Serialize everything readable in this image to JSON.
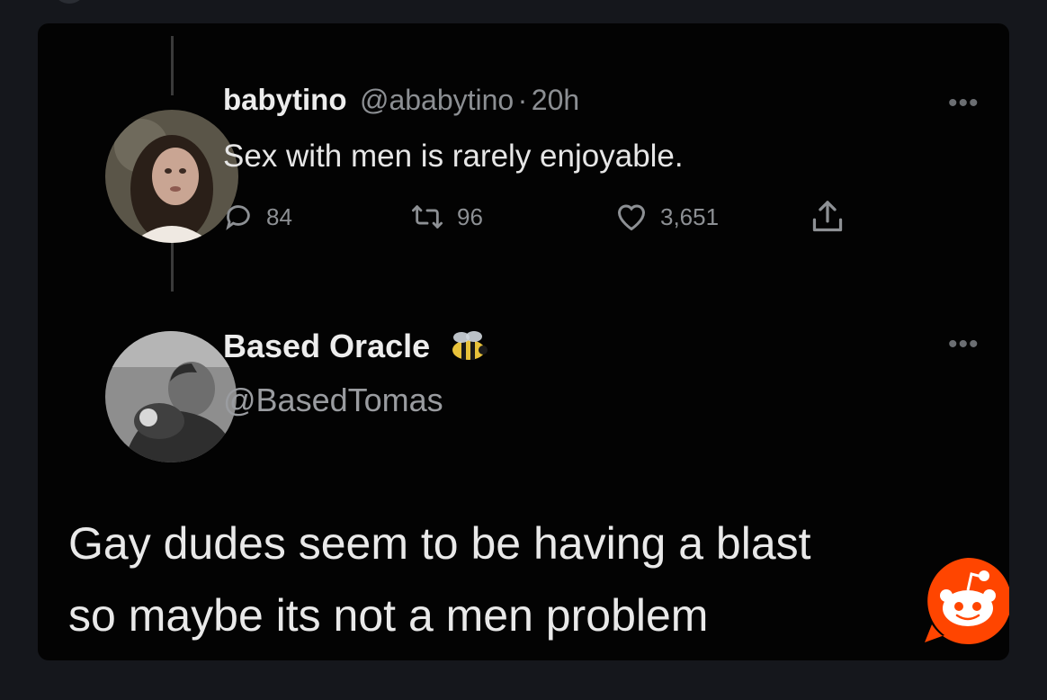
{
  "tweet1": {
    "display_name": "babytino",
    "handle": "@ababytino",
    "separator": "·",
    "time": "20h",
    "text": "Sex with men is rarely enjoyable.",
    "reply_count": "84",
    "retweet_count": "96",
    "like_count": "3,651"
  },
  "tweet2": {
    "display_name": "Based Oracle",
    "handle": "@BasedTomas",
    "text_line1": "Gay dudes seem to be having a blast",
    "text_line2": "so maybe its not a men problem"
  },
  "icons": {
    "reply": "reply-icon",
    "retweet": "retweet-icon",
    "like": "heart-icon",
    "share": "share-icon",
    "more": "more-icon",
    "bee": "bee-emoji-icon",
    "badge": "reddit-logo-icon"
  },
  "colors": {
    "background": "#15171c",
    "card": "#030303",
    "text": "#e7e7e7",
    "muted": "#8c8f93",
    "reddit_orange": "#ff4500"
  }
}
